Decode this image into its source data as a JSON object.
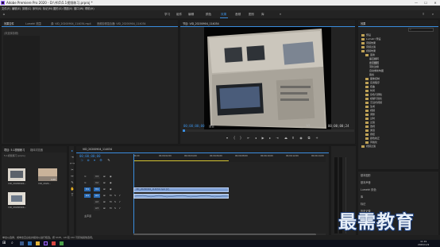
{
  "window": {
    "title": "Adobe Premiere Pro 2020 - D:\\书\\5\\5.1视频练习.prproj *",
    "minimize": "—",
    "maximize": "☐",
    "close": "✕"
  },
  "menu": [
    "文件(F)",
    "编辑(E)",
    "剪辑(C)",
    "序列(S)",
    "标记(M)",
    "图形(G)",
    "视图(V)",
    "窗口(W)",
    "帮助(H)"
  ],
  "workspaces": {
    "items": [
      "学习",
      "组件",
      "编辑",
      "颜色",
      "效果",
      "音频",
      "图形",
      "库"
    ],
    "active_index": 4
  },
  "source_panel": {
    "tabs": [
      "效果控件",
      "Lumetri 范围",
      "源: VID_20200904_114034.mp4",
      "音频剪辑混合器: VID_20200904_114034"
    ],
    "active_tab": 0,
    "message": "(未选择剪辑)"
  },
  "program_monitor": {
    "title": "节目: VID_20200904_114034",
    "timecode_current": "00;00;00;00",
    "fit_label": "适合",
    "quality": "1/2",
    "timecode_total": "00;00;00;24"
  },
  "effects_panel": {
    "title": "效果",
    "search_placeholder": "",
    "items": [
      {
        "label": "预设",
        "depth": 0,
        "open": false
      },
      {
        "label": "Lumetri 预设",
        "depth": 0,
        "open": false
      },
      {
        "label": "音频效果",
        "depth": 0,
        "open": false
      },
      {
        "label": "音频过渡",
        "depth": 0,
        "open": false
      },
      {
        "label": "视频效果",
        "depth": 0,
        "open": true
      },
      {
        "label": "变换",
        "depth": 1,
        "open": true
      },
      {
        "label": "垂直翻转",
        "depth": 2,
        "open": false
      },
      {
        "label": "水平翻转",
        "depth": 2,
        "open": false,
        "selected": true
      },
      {
        "label": "羽化边缘",
        "depth": 2,
        "open": false
      },
      {
        "label": "自动重新构图",
        "depth": 2,
        "open": false
      },
      {
        "label": "裁剪",
        "depth": 2,
        "open": false
      },
      {
        "label": "图像控制",
        "depth": 1,
        "open": false
      },
      {
        "label": "实用程序",
        "depth": 1,
        "open": false
      },
      {
        "label": "扭曲",
        "depth": 1,
        "open": false
      },
      {
        "label": "时间",
        "depth": 1,
        "open": false
      },
      {
        "label": "杂色与颗粒",
        "depth": 1,
        "open": false
      },
      {
        "label": "模糊与锐化",
        "depth": 1,
        "open": false
      },
      {
        "label": "沉浸式视频",
        "depth": 1,
        "open": false
      },
      {
        "label": "生成",
        "depth": 1,
        "open": false
      },
      {
        "label": "视频",
        "depth": 1,
        "open": false
      },
      {
        "label": "调整",
        "depth": 1,
        "open": false
      },
      {
        "label": "过时",
        "depth": 1,
        "open": false
      },
      {
        "label": "过渡",
        "depth": 1,
        "open": false
      },
      {
        "label": "透视",
        "depth": 1,
        "open": false
      },
      {
        "label": "通道",
        "depth": 1,
        "open": false
      },
      {
        "label": "键控",
        "depth": 1,
        "open": false
      },
      {
        "label": "颜色校正",
        "depth": 1,
        "open": false
      },
      {
        "label": "风格化",
        "depth": 1,
        "open": false
      },
      {
        "label": "视频过渡",
        "depth": 0,
        "open": false
      }
    ],
    "extra_panels": [
      "基本图形",
      "基本声音",
      "Lumetri 颜色",
      "库",
      "标记",
      "历史记录",
      "信息"
    ]
  },
  "project_panel": {
    "tabs": [
      "项目: 5.1视频练习",
      "媒体浏览器"
    ],
    "path": "5.1视频练习.prproj",
    "items": [
      {
        "name": "VID_20200904...",
        "duration": "4;29"
      },
      {
        "name": "VID_2020...",
        "duration": "4;29"
      },
      {
        "name": "VID_20200904...",
        "duration": "4;29"
      }
    ]
  },
  "timeline": {
    "tab": "VID_20200904_114034",
    "timecode": "00;00;00;00",
    "ruler_ticks": [
      "00;00",
      "00;00;02;00",
      "00;00;04;00",
      "00;00;06;00",
      "00;00;08;00",
      "00;00;10;00",
      "00;00;12;00",
      "00;00;14;00"
    ],
    "video_tracks": [
      "V3",
      "V2",
      "V1"
    ],
    "audio_tracks": [
      "A1",
      "A2",
      "A3"
    ],
    "clips": [
      {
        "label": "VID_20200904_114034.mp4 [V]",
        "track": "V1"
      },
      {
        "label": "",
        "track": "A1"
      }
    ],
    "master": "主声道"
  },
  "status_bar": {
    "text": "单击以选择，或单击空白处并拖动以进行框选。按 Shift、Alt 和 Ctrl 可获得其他选项。"
  },
  "taskbar": {
    "time": "11:19",
    "date": "2020/11/9"
  },
  "watermark": {
    "text": "最需教育"
  }
}
